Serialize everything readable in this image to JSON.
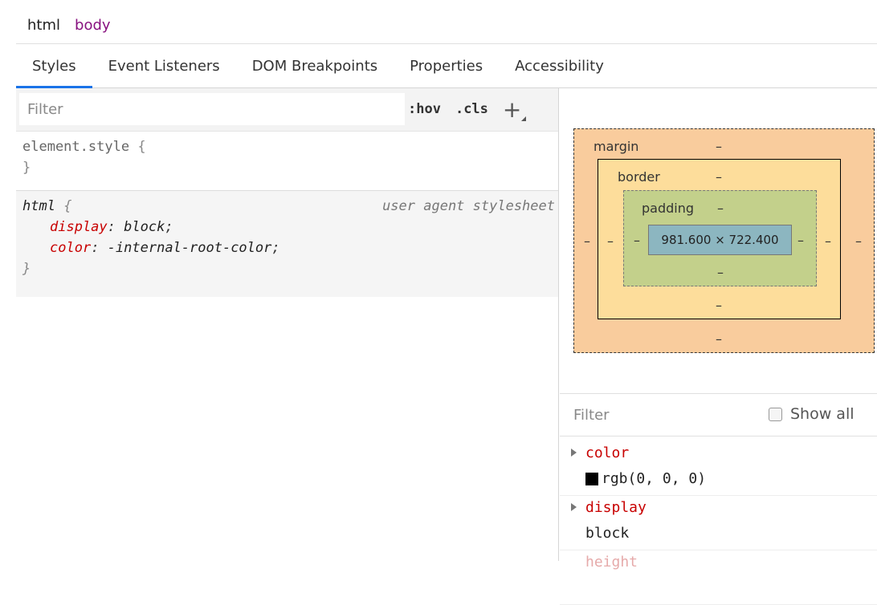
{
  "breadcrumb": {
    "items": [
      "html",
      "body"
    ]
  },
  "tabs": [
    "Styles",
    "Event Listeners",
    "DOM Breakpoints",
    "Properties",
    "Accessibility"
  ],
  "styles": {
    "filter_placeholder": "Filter",
    "hov_label": ":hov",
    "cls_label": ".cls",
    "add_label": "+",
    "element_style": {
      "selector": "element.style",
      "open": "{",
      "close": "}"
    },
    "ua_rule": {
      "selector": "html",
      "open": "{",
      "source": "user agent stylesheet",
      "properties": [
        {
          "name": "display",
          "value": "block"
        },
        {
          "name": "color",
          "value": "-internal-root-color"
        }
      ],
      "close": "}"
    }
  },
  "box_model": {
    "margin_label": "margin",
    "border_label": "border",
    "padding_label": "padding",
    "dash": "–",
    "content_size": "981.600 × 722.400"
  },
  "computed": {
    "filter_placeholder": "Filter",
    "show_all_label": "Show all",
    "properties": [
      {
        "name": "color",
        "value": "rgb(0, 0, 0)",
        "swatch": "#000000"
      },
      {
        "name": "display",
        "value": "block"
      },
      {
        "name": "height",
        "value": ""
      }
    ]
  }
}
